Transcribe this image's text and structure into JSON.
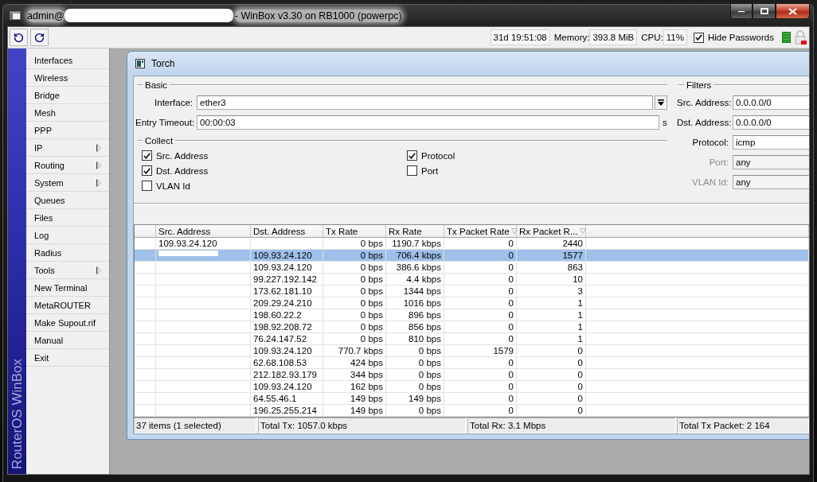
{
  "window": {
    "title_start": "admin@",
    "title_end": "- WinBox v3.30 on RB1000 (powerpc)"
  },
  "toolbar": {
    "uptime": "31d 19:51:08",
    "memory_label": "Memory:",
    "memory": "393.8 MiB",
    "cpu_label": "CPU:",
    "cpu": "11%",
    "hide_passwords": {
      "label": "Hide Passwords",
      "checked": true
    }
  },
  "sidebar": {
    "brand": "RouterOS WinBox",
    "items": [
      {
        "label": "Interfaces",
        "submenu": false
      },
      {
        "label": "Wireless",
        "submenu": false
      },
      {
        "label": "Bridge",
        "submenu": false
      },
      {
        "label": "Mesh",
        "submenu": false
      },
      {
        "label": "PPP",
        "submenu": false
      },
      {
        "label": "IP",
        "submenu": true
      },
      {
        "label": "Routing",
        "submenu": true
      },
      {
        "label": "System",
        "submenu": true
      },
      {
        "label": "Queues",
        "submenu": false
      },
      {
        "label": "Files",
        "submenu": false
      },
      {
        "label": "Log",
        "submenu": false
      },
      {
        "label": "Radius",
        "submenu": false
      },
      {
        "label": "Tools",
        "submenu": true
      },
      {
        "label": "New Terminal",
        "submenu": false
      },
      {
        "label": "MetaROUTER",
        "submenu": false
      },
      {
        "label": "Make Supout.rif",
        "submenu": false
      },
      {
        "label": "Manual",
        "submenu": false
      },
      {
        "label": "Exit",
        "submenu": false
      }
    ]
  },
  "torch": {
    "title": "Torch",
    "basic": {
      "legend": "Basic",
      "interface": {
        "label": "Interface:",
        "value": "ether3"
      },
      "entry_timeout": {
        "label": "Entry Timeout:",
        "value": "00:00:03",
        "unit": "s"
      }
    },
    "collect": {
      "legend": "Collect",
      "columns": [
        [
          {
            "label": "Src. Address",
            "checked": true
          },
          {
            "label": "Dst. Address",
            "checked": true
          },
          {
            "label": "VLAN Id",
            "checked": false
          }
        ],
        [
          {
            "label": "Protocol",
            "checked": true
          },
          {
            "label": "Port",
            "checked": false
          }
        ]
      ]
    },
    "filters": {
      "legend": "Filters",
      "fields": [
        {
          "label": "Src. Address:",
          "value": "0.0.0.0/0",
          "disabled": false
        },
        {
          "label": "Dst. Address:",
          "value": "0.0.0.0/0",
          "disabled": false
        },
        {
          "label": "Protocol:",
          "value": "icmp",
          "disabled": false
        },
        {
          "label": "Port:",
          "value": "any",
          "disabled": true
        },
        {
          "label": "VLAN Id:",
          "value": "any",
          "disabled": true
        }
      ]
    },
    "table": {
      "columns": [
        {
          "label": "Src. Address",
          "sort_icon": false
        },
        {
          "label": "Dst. Address",
          "sort_icon": false
        },
        {
          "label": "Tx Rate",
          "sort_icon": false
        },
        {
          "label": "Rx Rate",
          "sort_icon": false
        },
        {
          "label": "Tx Packet Rate",
          "sort_icon": true
        },
        {
          "label": "Rx Packet R...",
          "sort_icon": true
        }
      ],
      "rows": [
        {
          "selected": false,
          "src": "109.93.24.120",
          "tx_rate": "0 bps",
          "rx_rate": "1190.7 kbps",
          "tx_packet_rate": "0",
          "rx_packet_rate": "2440"
        },
        {
          "selected": true,
          "dst": "109.93.24.120",
          "tx_rate": "0 bps",
          "rx_rate": "706.4 kbps",
          "tx_packet_rate": "0",
          "rx_packet_rate": "1577"
        },
        {
          "selected": false,
          "dst": "109.93.24.120",
          "tx_rate": "0 bps",
          "rx_rate": "386.6 kbps",
          "tx_packet_rate": "0",
          "rx_packet_rate": "863"
        },
        {
          "selected": false,
          "dst": "99.227.192.142",
          "tx_rate": "0 bps",
          "rx_rate": "4.4 kbps",
          "tx_packet_rate": "0",
          "rx_packet_rate": "10"
        },
        {
          "selected": false,
          "dst": "173.62.181.10",
          "tx_rate": "0 bps",
          "rx_rate": "1344 bps",
          "tx_packet_rate": "0",
          "rx_packet_rate": "3"
        },
        {
          "selected": false,
          "dst": "209.29.24.210",
          "tx_rate": "0 bps",
          "rx_rate": "1016 bps",
          "tx_packet_rate": "0",
          "rx_packet_rate": "1"
        },
        {
          "selected": false,
          "dst": "198.60.22.2",
          "tx_rate": "0 bps",
          "rx_rate": "896 bps",
          "tx_packet_rate": "0",
          "rx_packet_rate": "1"
        },
        {
          "selected": false,
          "dst": "198.92.208.72",
          "tx_rate": "0 bps",
          "rx_rate": "856 bps",
          "tx_packet_rate": "0",
          "rx_packet_rate": "1"
        },
        {
          "selected": false,
          "dst": "76.24.147.52",
          "tx_rate": "0 bps",
          "rx_rate": "810 bps",
          "tx_packet_rate": "0",
          "rx_packet_rate": "1"
        },
        {
          "selected": false,
          "dst": "109.93.24.120",
          "tx_rate": "770.7 kbps",
          "rx_rate": "0 bps",
          "tx_packet_rate": "1579",
          "rx_packet_rate": "0"
        },
        {
          "selected": false,
          "dst": "62.68.108.53",
          "tx_rate": "424 bps",
          "rx_rate": "0 bps",
          "tx_packet_rate": "0",
          "rx_packet_rate": "0"
        },
        {
          "selected": false,
          "dst": "212.182.93.179",
          "tx_rate": "344 bps",
          "rx_rate": "0 bps",
          "tx_packet_rate": "0",
          "rx_packet_rate": "0"
        },
        {
          "selected": false,
          "dst": "109.93.24.120",
          "tx_rate": "162 bps",
          "rx_rate": "0 bps",
          "tx_packet_rate": "0",
          "rx_packet_rate": "0"
        },
        {
          "selected": false,
          "dst": "64.55.46.1",
          "tx_rate": "149 bps",
          "rx_rate": "149 bps",
          "tx_packet_rate": "0",
          "rx_packet_rate": "0"
        },
        {
          "selected": false,
          "dst": "196.25.255.214",
          "tx_rate": "149 bps",
          "rx_rate": "0 bps",
          "tx_packet_rate": "0",
          "rx_packet_rate": "0"
        }
      ]
    },
    "status_bar": [
      "37 items (1 selected)",
      "Total Tx: 1057.0 kbps",
      "Total Rx: 3.1 Mbps",
      "Total Tx Packet: 2 164"
    ]
  }
}
